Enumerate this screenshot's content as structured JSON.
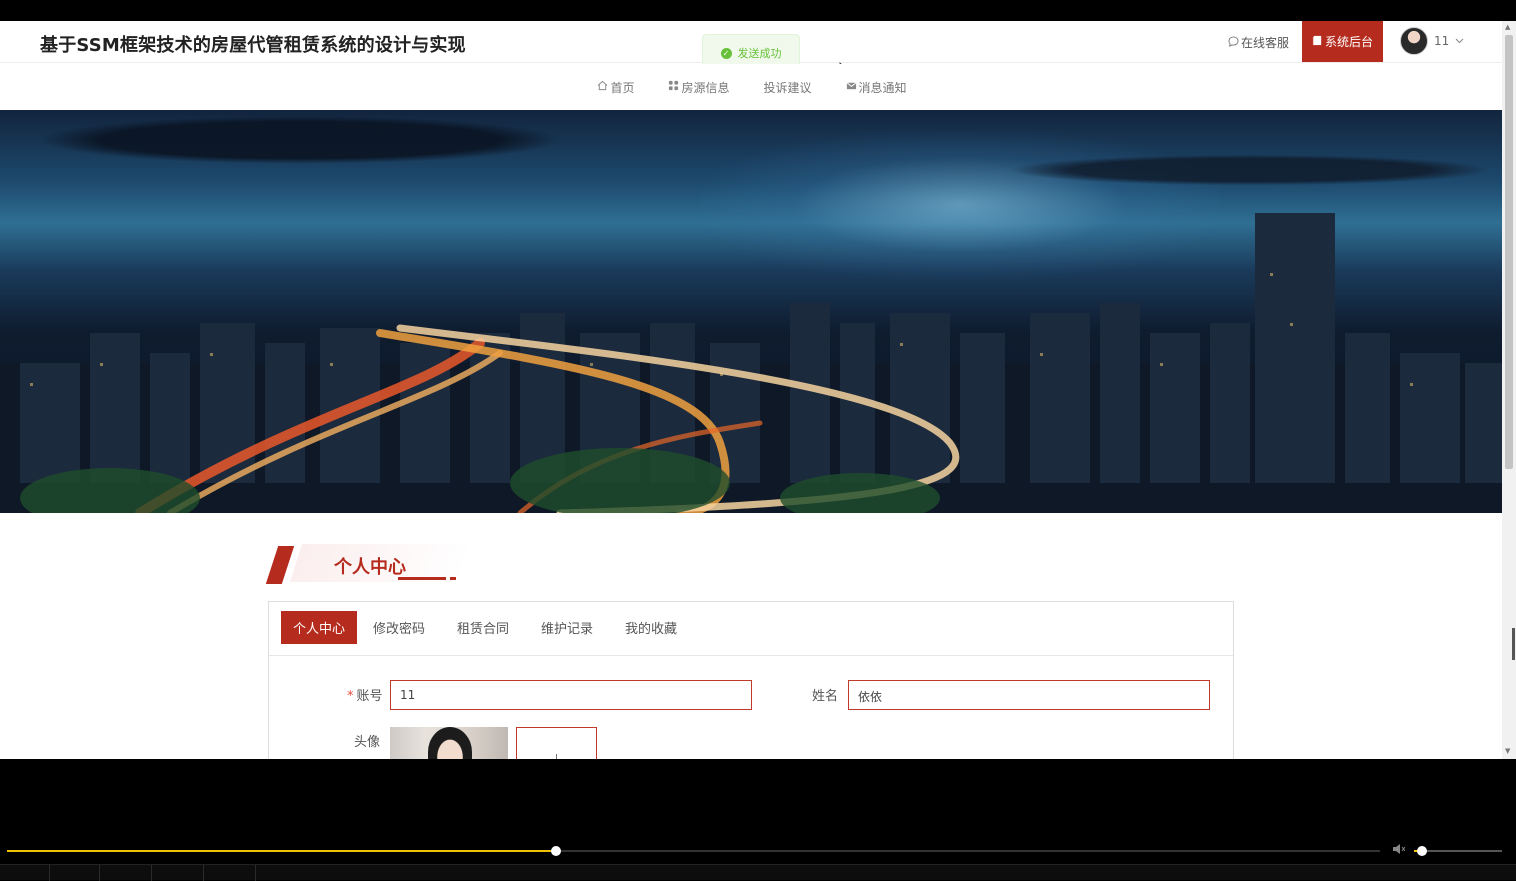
{
  "site": {
    "title": "基于SSM框架技术的房屋代管租赁系统的设计与实现"
  },
  "header": {
    "online_service": "在线客服",
    "admin_button": "系统后台",
    "user_name": "11"
  },
  "toast": {
    "message": "发送成功"
  },
  "nav": {
    "items": [
      {
        "label": "首页",
        "icon": "home-icon"
      },
      {
        "label": "房源信息",
        "icon": "grid-icon"
      },
      {
        "label": "投诉建议",
        "icon": ""
      },
      {
        "label": "消息通知",
        "icon": "mail-icon"
      }
    ]
  },
  "section": {
    "title": "个人中心"
  },
  "tabs": [
    {
      "label": "个人中心",
      "active": true
    },
    {
      "label": "修改密码",
      "active": false
    },
    {
      "label": "租赁合同",
      "active": false
    },
    {
      "label": "维护记录",
      "active": false
    },
    {
      "label": "我的收藏",
      "active": false
    }
  ],
  "form": {
    "account_label": "账号",
    "account_value": "11",
    "name_label": "姓名",
    "name_value": "依依",
    "avatar_label": "头像"
  },
  "player": {
    "progress": 0.4,
    "volume": 0.05,
    "accent_color": "#f0c000"
  },
  "colors": {
    "brand": "#b52b1e",
    "toast_success": "#67c23a"
  }
}
